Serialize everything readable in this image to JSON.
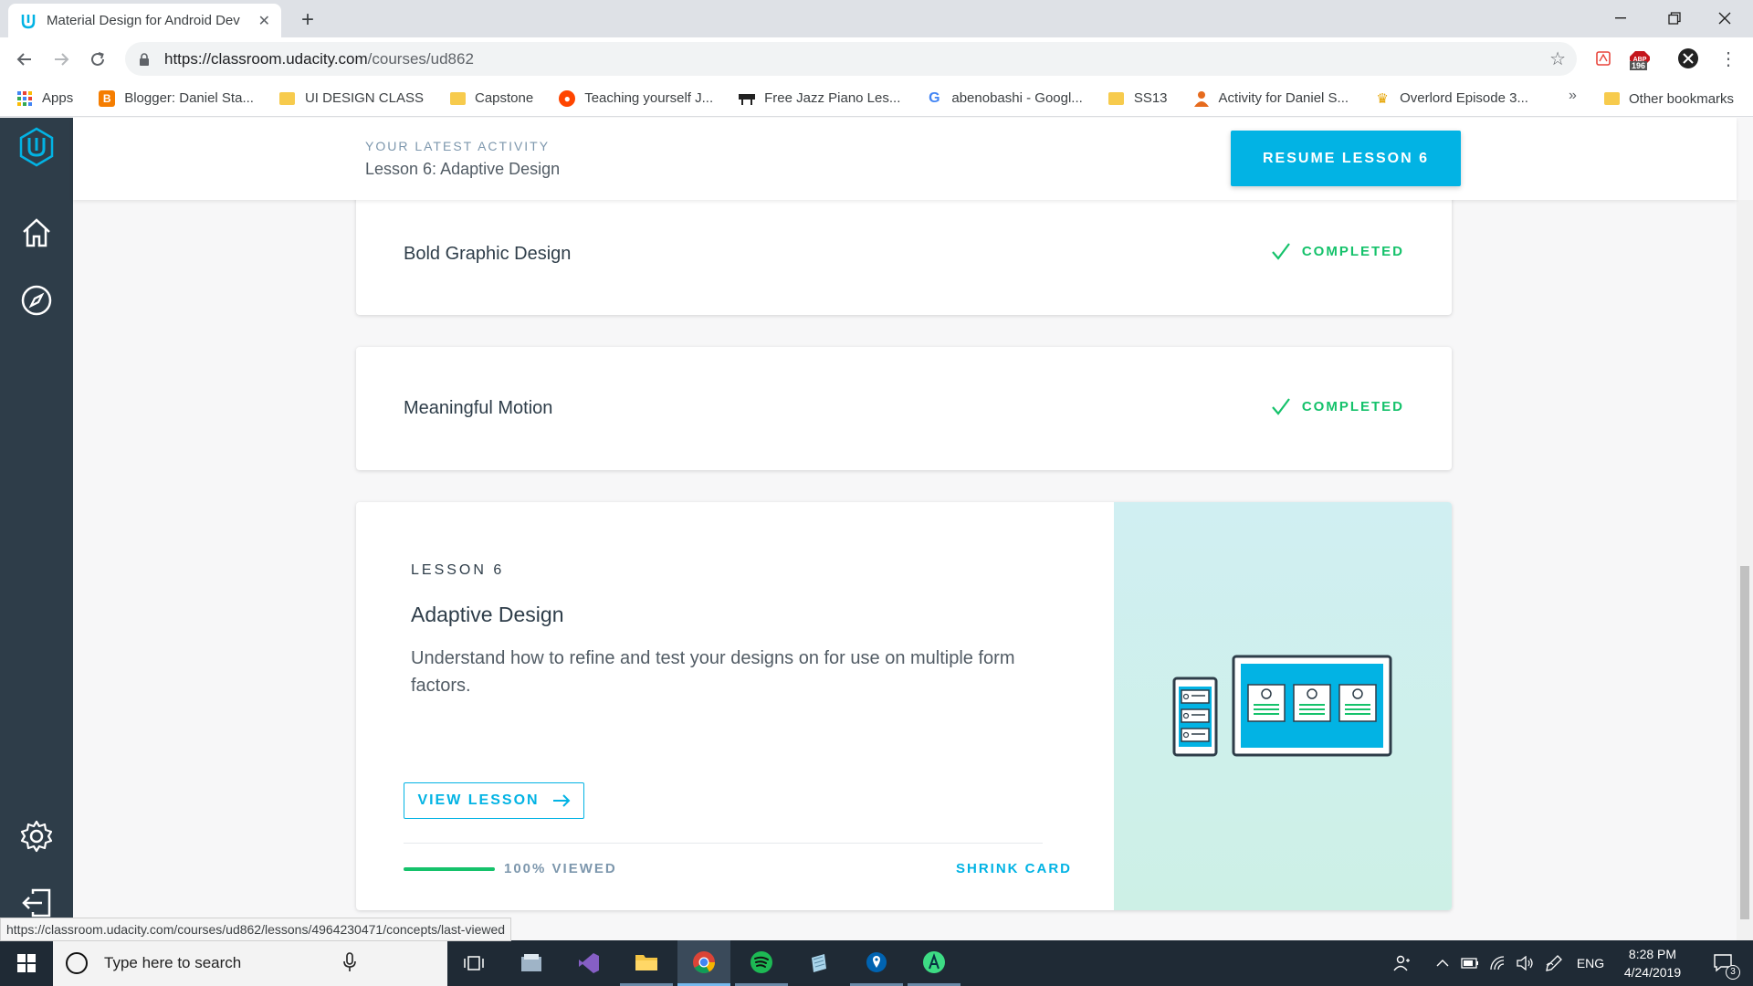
{
  "browser": {
    "tab_title": "Material Design for Android Dev",
    "url_host": "https://classroom.udacity.com",
    "url_path": "/courses/ud862",
    "ext_badge": "196",
    "bookmarks": [
      {
        "label": "Apps",
        "icon": "apps-grid-icon"
      },
      {
        "label": "Blogger: Daniel Sta...",
        "icon": "blogger-icon"
      },
      {
        "label": "UI DESIGN CLASS",
        "icon": "folder-icon"
      },
      {
        "label": "Capstone",
        "icon": "folder-icon"
      },
      {
        "label": "Teaching yourself J...",
        "icon": "reddit-icon"
      },
      {
        "label": "Free Jazz Piano Les...",
        "icon": "piano-icon"
      },
      {
        "label": "abenobashi - Googl...",
        "icon": "google-icon"
      },
      {
        "label": "SS13",
        "icon": "folder-icon"
      },
      {
        "label": "Activity for Daniel S...",
        "icon": "user-icon"
      },
      {
        "label": "Overlord Episode 3...",
        "icon": "crown-icon"
      }
    ],
    "more": "»",
    "other_bookmarks": "Other bookmarks",
    "status_url": "https://classroom.udacity.com/courses/ud862/lessons/4964230471/concepts/last-viewed"
  },
  "header": {
    "activity_label": "YOUR LATEST ACTIVITY",
    "activity_title": "Lesson 6: Adaptive Design",
    "resume_label": "RESUME LESSON 6"
  },
  "lessons": [
    {
      "title": "Bold Graphic Design",
      "status": "COMPLETED"
    },
    {
      "title": "Meaningful Motion",
      "status": "COMPLETED"
    }
  ],
  "current_lesson": {
    "number_label": "LESSON 6",
    "title": "Adaptive Design",
    "description": "Understand how to refine and test your designs on for use on multiple form factors.",
    "view_label": "VIEW LESSON",
    "progress_percent": 100,
    "viewed_label": "100% VIEWED",
    "shrink_label": "SHRINK CARD"
  },
  "colors": {
    "accent": "#02b3e4",
    "success": "#15c26b",
    "sidebar": "#2e3d49"
  },
  "taskbar": {
    "search_placeholder": "Type here to search",
    "lang": "ENG",
    "time": "8:28 PM",
    "date": "4/24/2019",
    "notifications": "3"
  }
}
